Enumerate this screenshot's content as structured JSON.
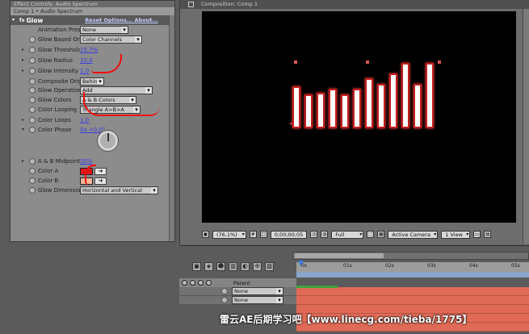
{
  "effects_panel": {
    "title_strip": "Effect Controls: Audio Spectrum",
    "comp_strip": "Comp 1 • Audio Spectrum",
    "effect": {
      "name": "Glow",
      "links": "Reset  Options...  About..."
    },
    "properties": [
      {
        "label": "Animation Presets",
        "value": "None",
        "kind": "dropdown"
      },
      {
        "label": "Glow Based On",
        "value": "Color Channels",
        "kind": "dropdown"
      },
      {
        "label": "Glow Threshold",
        "value": "15.7%",
        "kind": "value"
      },
      {
        "label": "Glow Radius",
        "value": "10.0",
        "kind": "value"
      },
      {
        "label": "Glow Intensity",
        "value": "1.0",
        "kind": "value"
      },
      {
        "label": "Composite Original",
        "value": "Behind",
        "kind": "dropdown"
      },
      {
        "label": "Glow Operation",
        "value": "Add",
        "kind": "dropdown"
      },
      {
        "label": "Glow Colors",
        "value": "A & B Colors",
        "kind": "dropdown"
      },
      {
        "label": "Color Looping",
        "value": "Triangle A>B>A",
        "kind": "dropdown"
      },
      {
        "label": "Color Loops",
        "value": "1.0",
        "kind": "value"
      },
      {
        "label": "Color Phase",
        "value": "0x +0.0°",
        "kind": "value"
      },
      {
        "label": "A & B Midpoint",
        "value": "50%",
        "kind": "value"
      },
      {
        "label": "Color A",
        "value": "#e01818",
        "kind": "color"
      },
      {
        "label": "Color B",
        "value": "#f2b69a",
        "kind": "color"
      },
      {
        "label": "Glow Dimensions",
        "value": "Horizontal and Vertical",
        "kind": "dropdown"
      }
    ]
  },
  "composition": {
    "tab_title": "Composition: Comp 1",
    "bars": [
      {
        "value": 0.4
      },
      {
        "value": 0.32
      },
      {
        "value": 0.34
      },
      {
        "value": 0.38
      },
      {
        "value": 0.32
      },
      {
        "value": 0.38
      },
      {
        "value": 0.48
      },
      {
        "value": 0.42
      },
      {
        "value": 0.52
      },
      {
        "value": 0.62
      },
      {
        "value": 0.42
      },
      {
        "value": 0.62
      }
    ],
    "bottombar": {
      "zoom": "(76.1%)",
      "timecode": "0;00;00;05",
      "resolution": "Full",
      "camera": "Active Camera",
      "view": "1 View"
    }
  },
  "timeline": {
    "ruler_ticks": [
      "0s",
      "01s",
      "02s",
      "03s",
      "04s",
      "05s"
    ],
    "header_label": "Parent",
    "layers": [
      {
        "parent": "None"
      },
      {
        "parent": "None"
      }
    ]
  },
  "watermark": "雷云AE后期学习吧【www.linecg.com/tieba/1775】"
}
